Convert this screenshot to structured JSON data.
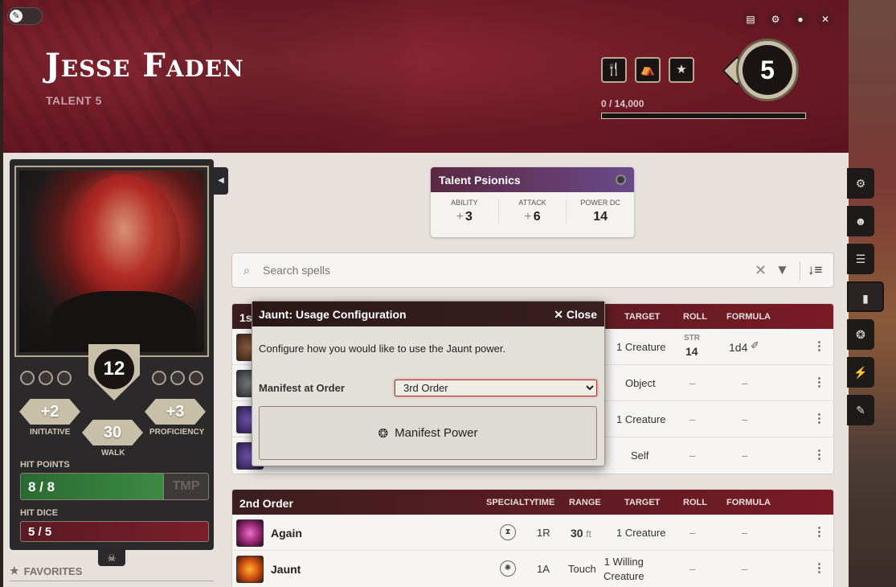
{
  "header": {
    "name": "Jesse Faden",
    "subtitle": "TALENT 5",
    "xp": "0 / 14,000",
    "level": "5",
    "window_buttons": [
      {
        "icon": "journal-icon",
        "glyph": "▤"
      },
      {
        "icon": "gear-icon",
        "glyph": "⚙"
      },
      {
        "icon": "user-icon",
        "glyph": "●"
      },
      {
        "icon": "close-icon",
        "glyph": "✕"
      }
    ],
    "rest_buttons": [
      {
        "icon": "utensils-icon",
        "glyph": "🍴"
      },
      {
        "icon": "campfire-icon",
        "glyph": "⛺"
      },
      {
        "icon": "star-icon",
        "glyph": "★"
      }
    ],
    "accent": "#6d1a25"
  },
  "character": {
    "ac": "12",
    "initiative": "+2",
    "initiative_label": "INITIATIVE",
    "proficiency": "+3",
    "proficiency_label": "PROFICIENCY",
    "walk": "30",
    "walk_label": "WALK",
    "hp_label": "HIT POINTS",
    "hp": "8 / 8",
    "hp_fraction": 1.0,
    "tmp_label": "TMP",
    "hd_label": "HIT DICE",
    "hd": "5 / 5",
    "favorites_label": "FAVORITES"
  },
  "psionics": {
    "title": "Talent Psionics",
    "ability_label": "ABILITY",
    "ability": "3",
    "attack_label": "ATTACK",
    "attack": "6",
    "dc_label": "POWER DC",
    "dc": "14",
    "sign": "+"
  },
  "search": {
    "placeholder": "Search spells"
  },
  "columns": {
    "specialty": "SPECIALTY",
    "time": "TIME",
    "range": "RANGE",
    "target": "TARGET",
    "roll": "ROLL",
    "formula": "FORMULA"
  },
  "order1": {
    "title": "1st Order",
    "rows": [
      {
        "target": "1 Creature",
        "roll_ability": "STR",
        "roll": "14",
        "formula": "1d4"
      },
      {
        "target": "Object",
        "roll": "–",
        "formula": "–"
      },
      {
        "target": "1 Creature",
        "roll": "–",
        "formula": "–"
      },
      {
        "target": "Self",
        "roll": "–",
        "formula": "–"
      }
    ]
  },
  "order2": {
    "title": "2nd Order",
    "rows": [
      {
        "name": "Again",
        "time": "1R",
        "range_value": "30",
        "range_unit": "ft",
        "target": "1 Creature",
        "roll": "–",
        "formula": "–"
      },
      {
        "name": "Jaunt",
        "time": "1A",
        "range": "Touch",
        "target_line1": "1 Willing",
        "target_line2": "Creature",
        "roll": "–",
        "formula": "–"
      }
    ]
  },
  "dialog": {
    "title": "Jaunt: Usage Configuration",
    "close": "Close",
    "description": "Configure how you would like to use the Jaunt power.",
    "manifest_label": "Manifest at Order",
    "manifest_value": "3rd Order",
    "button": "Manifest Power"
  },
  "sidebar_tabs": [
    {
      "icon": "gear-icon",
      "glyph": "⚙"
    },
    {
      "icon": "character-icon",
      "glyph": "☻"
    },
    {
      "icon": "list-icon",
      "glyph": "☰"
    },
    {
      "icon": "book-icon",
      "glyph": "▮"
    },
    {
      "icon": "brain-icon",
      "glyph": "❂"
    },
    {
      "icon": "lightning-icon",
      "glyph": "⚡"
    },
    {
      "icon": "feather-icon",
      "glyph": "✎"
    }
  ]
}
